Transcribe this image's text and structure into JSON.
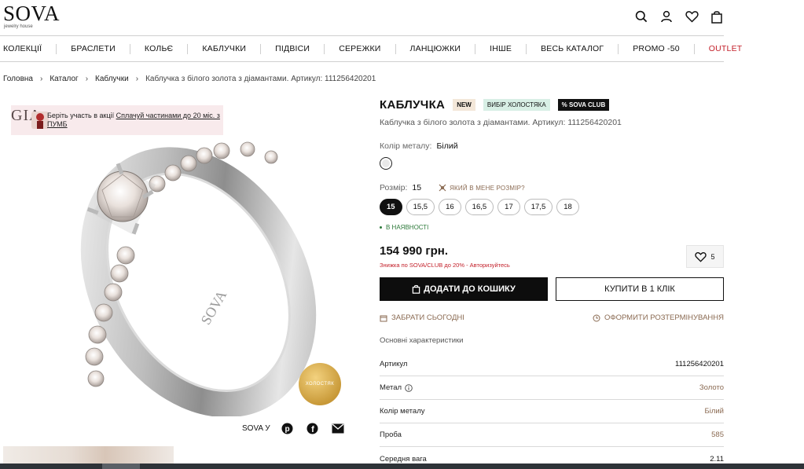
{
  "header": {
    "logo": "SOVA",
    "logo_sub": "jewelry house",
    "icons": [
      "search-icon",
      "account-icon",
      "heart-icon",
      "bag-icon"
    ]
  },
  "nav": {
    "items": [
      "КОЛЕКЦІЇ",
      "БРАСЛЕТИ",
      "КОЛЬЄ",
      "КАБЛУЧКИ",
      "ПІДВІСИ",
      "СЕРЕЖКИ",
      "ЛАНЦЮЖКИ",
      "ІНШЕ",
      "ВЕСЬ КАТАЛОГ",
      "PROMO -50"
    ],
    "outlet": "OUTLET"
  },
  "breadcrumbs": {
    "home": "Головна",
    "catalog": "Каталог",
    "category": "Каблучки",
    "current": "Каблучка з білого золота з діамантами. Артикул: 111256420201"
  },
  "promo": {
    "logo": "GIA",
    "text_before": "Беріть участь в акції ",
    "link": "Сплачуй частинами до 20 міс. з ПУМБ"
  },
  "badge": "ХОЛОСТЯК",
  "share": {
    "label": "SOVA У"
  },
  "product": {
    "title": "КАБЛУЧКА",
    "tags": {
      "new": "NEW",
      "choice": "ВИБІР ХОЛОСТЯКА",
      "club": "% SOVA CLUB"
    },
    "subtitle": "Каблучка з білого золота з діамантами. Артикул: 111256420201",
    "metal_label": "Колір металу:",
    "metal_value": "Білий",
    "size_label": "Розмір:",
    "size_value": "15",
    "size_help": "ЯКИЙ В МЕНЕ РОЗМІР?",
    "sizes": [
      "15",
      "15,5",
      "16",
      "16,5",
      "17",
      "17,5",
      "18"
    ],
    "selected_size": "15",
    "stock": "В НАЯВНОСТІ",
    "price": "154 990 грн.",
    "discount_note": "Знижка по SOVA/CLUB до 20% - Авторизуйтесь",
    "wishlist_count": "5",
    "add_to_cart": "ДОДАТИ ДО КОШИКУ",
    "buy_one_click": "КУПИТИ В 1 КЛІК",
    "pickup_today": "ЗАБРАТИ СЬОГОДНІ",
    "installment": "ОФОРМИТИ РОЗТЕРМІНУВАННЯ",
    "specs_title": "Основні характеристики",
    "specs": [
      {
        "key": "Артикул",
        "value": "111256420201"
      },
      {
        "key": "Метал",
        "value": "Золото"
      },
      {
        "key": "Колір металу",
        "value": "Білий"
      },
      {
        "key": "Проба",
        "value": "585"
      },
      {
        "key": "Середня вага",
        "value": "2.11"
      }
    ]
  },
  "colors": {
    "accent": "#8a6a52",
    "sale": "#c3202a",
    "stock": "#2e7a3b",
    "dark": "#0d0d0d"
  }
}
